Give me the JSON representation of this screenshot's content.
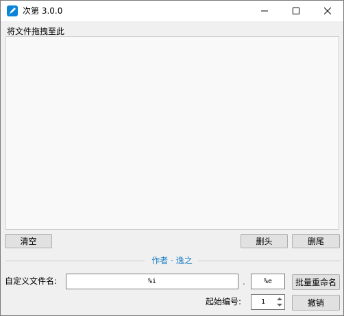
{
  "window": {
    "title": "次第 3.0.0",
    "app_icon": "pencil-check-icon",
    "controls": [
      "minimize-icon",
      "maximize-icon",
      "close-icon"
    ]
  },
  "drop": {
    "label": "将文件拖拽至此"
  },
  "buttons": {
    "clear": "清空",
    "delete_head": "删头",
    "delete_tail": "删尾",
    "batch_rename": "批量重命名",
    "undo": "撤销"
  },
  "credit": {
    "text": "作者 · 逸之"
  },
  "rename": {
    "filename_label": "自定义文件名:",
    "filename_value": "%i",
    "separator": ".",
    "extension_value": "%e",
    "start_label": "起始编号:",
    "start_value": "1"
  },
  "colors": {
    "accent": "#1c7fc4",
    "icon_blue": "#0a84d8"
  }
}
